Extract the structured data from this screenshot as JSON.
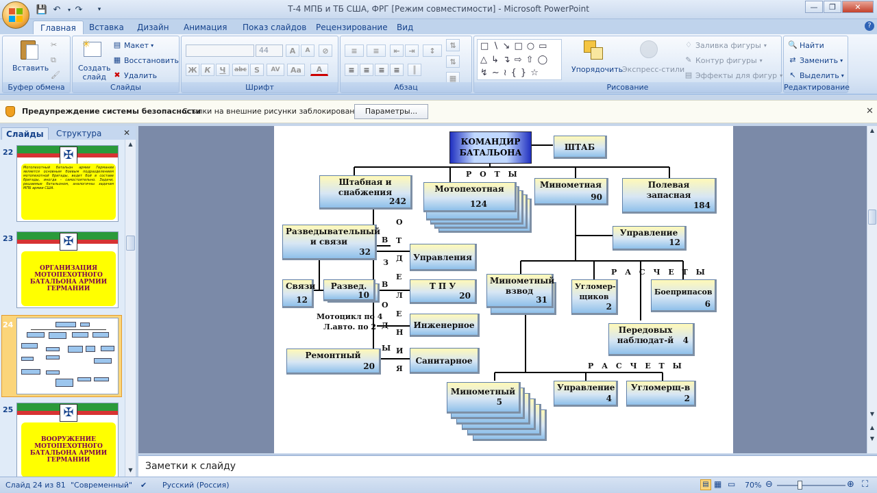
{
  "window": {
    "title": "Т-4 МПБ и ТБ США, ФРГ [Режим совместимости] - Microsoft PowerPoint",
    "quick_access": [
      "save-icon",
      "undo-icon",
      "redo-icon",
      "customize-icon"
    ]
  },
  "tabs": [
    "Главная",
    "Вставка",
    "Дизайн",
    "Анимация",
    "Показ слайдов",
    "Рецензирование",
    "Вид"
  ],
  "active_tab": "Главная",
  "ribbon": {
    "clipboard": {
      "label": "Буфер обмена",
      "paste": "Вставить"
    },
    "slides": {
      "label": "Слайды",
      "create": "Создать слайд",
      "layout": "Макет",
      "reset": "Восстановить",
      "delete": "Удалить"
    },
    "font": {
      "label": "Шрифт",
      "font_name": "",
      "font_size": "44",
      "bold": "Ж",
      "italic": "К",
      "underline": "Ч",
      "strike": "abc",
      "shadow": "S",
      "spacing": "AV",
      "case": "Aa",
      "color": "A"
    },
    "paragraph": {
      "label": "Абзац"
    },
    "drawing": {
      "label": "Рисование",
      "arrange": "Упорядочить",
      "quick_styles": "Экспресс-стили",
      "fill": "Заливка фигуры",
      "outline": "Контур фигуры",
      "effects": "Эффекты для фигур"
    },
    "editing": {
      "label": "Редактирование",
      "find": "Найти",
      "replace": "Заменить",
      "select": "Выделить"
    }
  },
  "security_bar": {
    "title": "Предупреждение системы безопасности",
    "message": "Ссылки на внешние рисунки заблокированы",
    "button": "Параметры..."
  },
  "left_panel": {
    "tab_slides": "Слайды",
    "tab_outline": "Структура",
    "slides": [
      {
        "num": "22",
        "text": "Мотопехотный батальон армии Германии является основным боевым подразделением мотопехотной бригады, ведет бой в составе бригады, иногда - самостоятельно. Задачи, решаемые батальоном, аналогичны задачам МПБ армии США."
      },
      {
        "num": "23",
        "text": "ОРГАНИЗАЦИЯ МОТОПЕХОТНОГО БАТАЛЬОНА АРМИИ ГЕРМАНИИ"
      },
      {
        "num": "24",
        "text": ""
      },
      {
        "num": "25",
        "text": "ВООРУЖЕНИЕ МОТОПЕХОТНОГО БАТАЛЬОНА АРМИИ ГЕРМАНИИ"
      }
    ]
  },
  "slide": {
    "commander": "КОМАНДИР БАТАЛЬОНА",
    "hq": "ШТАБ",
    "roty": "Р О Т Ы",
    "staff_supply": {
      "name": "Штабная и снабжения",
      "num": "242"
    },
    "motor_infantry": {
      "name": "Мотопехотная",
      "num": "124"
    },
    "mortar": {
      "name": "Минометная",
      "num": "90"
    },
    "field_reserve": {
      "name": "Полевая запасная",
      "num": "184"
    },
    "recon_comm": {
      "name": "Разведывательный и связи",
      "num": "32"
    },
    "comm": {
      "name": "Связи",
      "num": "12"
    },
    "recon": {
      "name": "Развед.",
      "num": "10"
    },
    "motorcycle": "Мотоцикл по 4",
    "light_auto": "Л.авто. по 2",
    "repair": {
      "name": "Ремонтный",
      "num": "20"
    },
    "otdeleniya": [
      "О",
      "Т",
      "Д",
      "Е",
      "Л",
      "Е",
      "Н",
      "И",
      "Я"
    ],
    "vzvody": [
      "В",
      "З",
      "В",
      "О",
      "Д",
      "Ы"
    ],
    "management": "Управления",
    "tpu": {
      "name": "Т П У",
      "num": "20"
    },
    "engineer": "Инженерное",
    "medical": "Санитарное",
    "mgmt12": {
      "name": "Управление",
      "num": "12"
    },
    "raschety1": "Р А С Ч Е Т Ы",
    "mortar_platoon": {
      "name": "Минометный взвод",
      "num": "31"
    },
    "goniometer": {
      "name": "Угломер-щиков",
      "num": "2"
    },
    "ammo": {
      "name": "Боеприпасов",
      "num": "6"
    },
    "observers": {
      "name": "Передовых наблюдат-й",
      "num": "4"
    },
    "raschety2": "Р А С Ч Е Т Ы",
    "mortar_crew": {
      "name": "Минометный",
      "num": "5"
    },
    "mgmt4": {
      "name": "Управление",
      "num": "4"
    },
    "gonio2": {
      "name": "Угломерщ-в",
      "num": "2"
    }
  },
  "notes_placeholder": "Заметки к слайду",
  "status": {
    "slide_info": "Слайд 24 из 81",
    "theme": "\"Современный\"",
    "language": "Русский (Россия)",
    "zoom": "70%"
  },
  "colors": {
    "accent": "#15428b",
    "ribbon": "#dbe7f6",
    "box_top": "#fff9b8",
    "box_bottom": "#8fc0ea"
  }
}
